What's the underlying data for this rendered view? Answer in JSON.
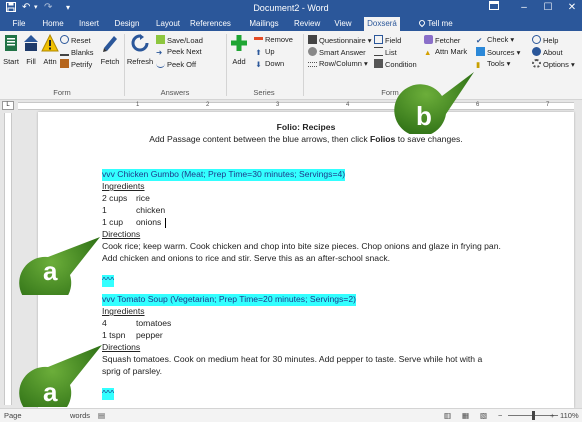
{
  "titlebar": {
    "title": "Document2 - Word",
    "icons": [
      "save-icon",
      "undo-icon",
      "redo-icon",
      "customize-icon"
    ],
    "window_controls": [
      "ribbon-display-icon",
      "minimize-icon",
      "maximize-icon",
      "close-icon"
    ]
  },
  "tabs": [
    {
      "label": "File"
    },
    {
      "label": "Home"
    },
    {
      "label": "Insert"
    },
    {
      "label": "Design"
    },
    {
      "label": "Layout"
    },
    {
      "label": "References"
    },
    {
      "label": "Mailings"
    },
    {
      "label": "Review"
    },
    {
      "label": "View"
    },
    {
      "label": "Doxserá"
    },
    {
      "label": "Tell me"
    }
  ],
  "active_tab": "Doxserá",
  "ribbon": {
    "form": {
      "label": "Form",
      "start": "Start",
      "fill": "Fill",
      "attn": "Attn",
      "reset": "Reset",
      "blanks": "Blanks",
      "petrify": "Petrify",
      "fetch": "Fetch"
    },
    "answers": {
      "label": "Answers",
      "refresh": "Refresh",
      "save_load": "Save/Load",
      "peek_next": "Peek Next",
      "peek_off": "Peek Off"
    },
    "series": {
      "label": "Series",
      "add": "Add",
      "remove": "Remove",
      "up": "Up",
      "down": "Down"
    },
    "form2": {
      "label": "Form",
      "questionnaire": "Questionnaire",
      "smart_answer": "Smart Answer",
      "row_column": "Row/Column",
      "field": "Field",
      "list": "List",
      "condition": "Condition"
    },
    "tools": {
      "fetcher": "Fetcher",
      "attn_mark": "Attn Mark",
      "check": "Check",
      "sources": "Sources",
      "tools": "Tools",
      "help": "Help",
      "about": "About",
      "options": "Options"
    }
  },
  "ruler": {
    "numbers": [
      "1",
      "2",
      "3",
      "4",
      "5",
      "6",
      "7"
    ]
  },
  "document": {
    "title": "Folio:  Recipes",
    "subtitle": "Add Passage content between the blue arrows, then click Folios to save changes.",
    "subtitle_pre": "Add Passage content between the blue arrows, then click ",
    "subtitle_bold": "Folios",
    "subtitle_post": " to save changes.",
    "recipe1": {
      "header": "vvv    Chicken Gumbo (Meat; Prep Time=30 minutes; Servings=4)",
      "ingredients_label": "Ingredients",
      "ingredients": [
        {
          "qty": "2 cups",
          "item": "rice"
        },
        {
          "qty": "1",
          "item": "chicken"
        },
        {
          "qty": "1 cup",
          "item": "onions"
        }
      ],
      "directions_label": "Directions",
      "directions_line1": "Cook rice; keep warm. Cook chicken and chop into bite size pieces.  Chop onions and glaze in frying pan.",
      "directions_line2": "Add chicken and onions to rice and stir.  Serve this as an after-school snack.",
      "end_marker": "^^^"
    },
    "recipe2": {
      "header": "vvv    Tomato Soup (Vegetarian; Prep Time=20 minutes; Servings=2)",
      "ingredients_label": "Ingredients",
      "ingredients": [
        {
          "qty": "4",
          "item": "tomatoes"
        },
        {
          "qty": "1 tspn",
          "item": "pepper"
        }
      ],
      "directions_label": "Directions",
      "directions_line1": "Squash tomatoes.  Cook on medium heat for 30 minutes.  Add pepper to taste.  Serve while hot with a",
      "directions_line2": "sprig of parsley.",
      "end_marker": "^^^"
    }
  },
  "status": {
    "page_label": "Page",
    "words_label": "words",
    "zoom": "110%"
  },
  "callouts": [
    {
      "letter": "a",
      "color": "#3a7d1e"
    },
    {
      "letter": "a",
      "color": "#3a7d1e"
    },
    {
      "letter": "b",
      "color": "#3a7d1e"
    }
  ],
  "colors": {
    "word_blue": "#2b579a",
    "highlight_cyan": "#33ffff",
    "callout_green": "#3a7d1e"
  }
}
